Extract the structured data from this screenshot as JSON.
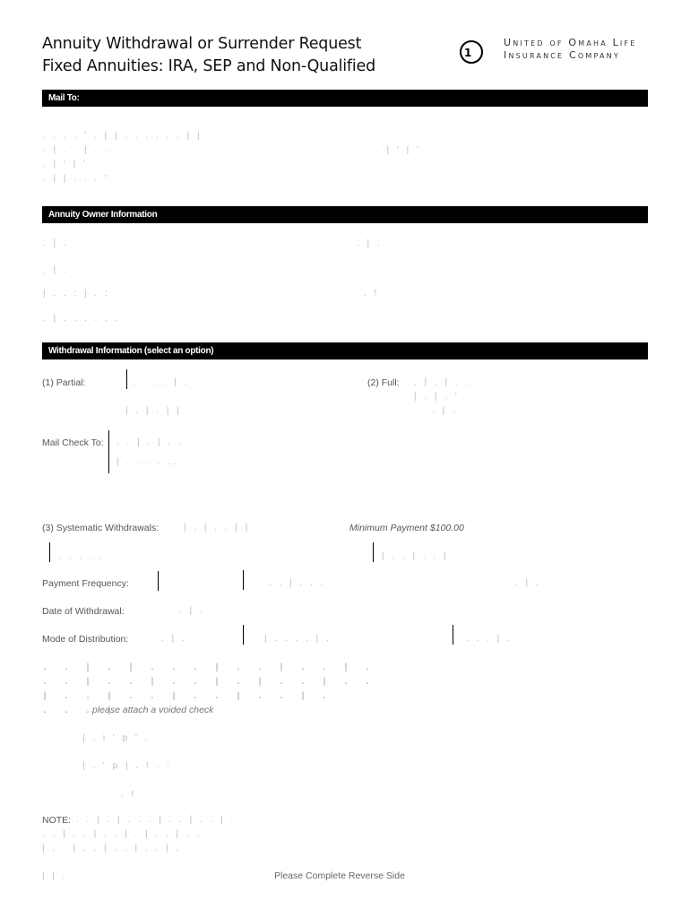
{
  "header": {
    "title_line1": "Annuity Withdrawal or Surrender Request",
    "title_line2": "Fixed Annuities: IRA, SEP and Non-Qualified",
    "company_line1": "United of Omaha Life",
    "company_line2": "Insurance Company",
    "logo_glyph": "1"
  },
  "sections": {
    "mail_to": "Mail To:",
    "owner_info": "Annuity Owner Information",
    "withdrawal_info": "Withdrawal Information (select an option)"
  },
  "withdrawal": {
    "partial_label": "(1) Partial:",
    "full_label": "(2) Full:",
    "mail_check_label": "Mail Check To:",
    "systematic_label": "(3) Systematic Withdrawals:",
    "minimum_payment": "Minimum Payment $100.00",
    "payment_frequency_label": "Payment Frequency:",
    "date_label": "Date of Withdrawal:",
    "mode_label": "Mode of Distribution:",
    "voided_check_note": "please attach a voided check"
  },
  "note": {
    "label": "NOTE:"
  },
  "footer": {
    "reverse_side": "Please Complete Reverse Side"
  },
  "faint": {
    "f1": ". . .   .   ' .  |  |  .  .  .   .  . . |  |",
    "f2": ".   |   .   .   |  .   .",
    "f3": ".  |   '  |   '",
    "f4": ".  | |  .   .   .   '",
    "f5": "| .  . | . :",
    "f6": ".  |  .",
    "f7": "| .  . : |  .  :",
    "f8": ". !",
    "f9": ". |  .  .  .  .  .  .",
    "f10": ".  .  .  . |  .",
    "f11": "| .  |  . | |",
    "f12": ". |  . | .  .",
    "f13": "| .  | .  '",
    "f14": ".  . |  .  |  .  .",
    "f15": "|  .  .  .  .  ..",
    "f16": "| .  | .  .  |  |",
    "f17": "| |  .",
    "f18": "i .  .  .  |",
    "f19": ".  |  .",
    "f20": ". .  .  .  .",
    "f21": "| .  .  |  .  .  |",
    "f22": ". .   |  .  .  .",
    "f23": "|  .   .  .   .  |  .",
    "f24": ".  .  .  |  .",
    "f25": "| .   i    '   p  '  .",
    "f26": "| .   ' p   |   .   !  . :",
    "f27": ".    r",
    "f28": ". .  |  .  |  .  .  .  |  .  .  |  .  .  |  .",
    "f29": ".  .  |  .  .  |  .  .  |  .  |  .  .  |  .  .",
    "f30": "|  .  .  |  .  .  |  .  .  |  .  .  |  .",
    "f31": ".  .  .  |"
  }
}
